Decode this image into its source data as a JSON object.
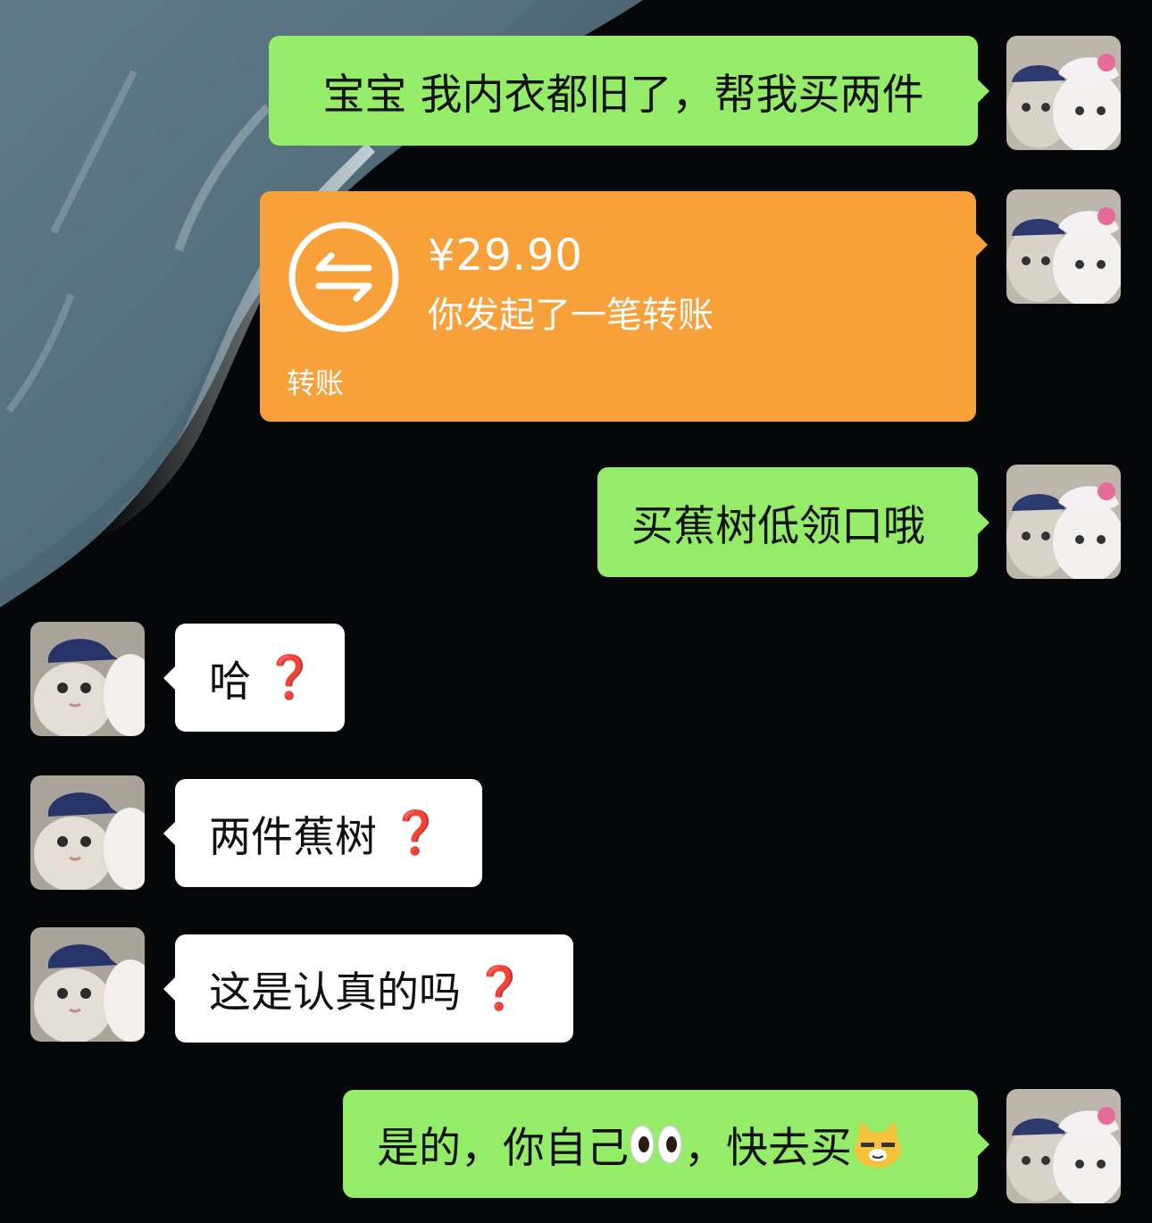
{
  "chat": {
    "messages": [
      {
        "sender": "me",
        "text": "宝宝 我内衣都旧了，帮我买两件"
      },
      {
        "sender": "me",
        "type": "transfer",
        "amount": "¥29.90",
        "description": "你发起了一笔转账",
        "label": "转账"
      },
      {
        "sender": "me",
        "text": "买蕉树低领口哦"
      },
      {
        "sender": "other",
        "text": "哈",
        "suffix": "❓"
      },
      {
        "sender": "other",
        "text": "两件蕉树",
        "suffix": "❓"
      },
      {
        "sender": "other",
        "text": "这是认真的吗",
        "suffix": "❓"
      },
      {
        "sender": "me",
        "segments": [
          "是的，你自己",
          "，快去买"
        ],
        "emojis": [
          "eyes-emoji",
          "smirking-cat-emoji"
        ]
      }
    ]
  },
  "colors": {
    "my_bubble": "#95ec69",
    "other_bubble": "#ffffff",
    "transfer_card": "#f8a13a",
    "question_mark": "#e0191f"
  }
}
